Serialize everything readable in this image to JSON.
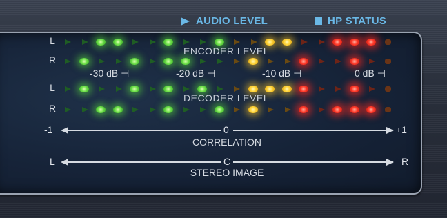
{
  "header": {
    "audio_level": "AUDIO LEVEL",
    "hp_status": "HP STATUS",
    "accent": "#6ab8e6"
  },
  "meters": {
    "encoder_label": "ENCODER LEVEL",
    "decoder_label": "DECODER LEVEL",
    "db_marks": [
      "-30 dB ⊣",
      "-20 dB ⊣",
      "-10 dB ⊣",
      "0 dB ⊣"
    ],
    "rows": [
      {
        "label": "L",
        "leds": [
          "og",
          "og",
          "g",
          "g",
          "og",
          "og",
          "g",
          "og",
          "og",
          "g",
          "oy",
          "oy",
          "y",
          "y",
          "or",
          "or",
          "r",
          "r",
          "r",
          "oo"
        ]
      },
      {
        "label": "R",
        "leds": [
          "og",
          "g",
          "og",
          "og",
          "g",
          "og",
          "g",
          "g",
          "og",
          "og",
          "oy",
          "y",
          "oy",
          "oy",
          "r",
          "or",
          "or",
          "r",
          "or",
          "oo"
        ]
      },
      {
        "label": "L",
        "leds": [
          "og",
          "g",
          "og",
          "og",
          "g",
          "og",
          "g",
          "og",
          "g",
          "og",
          "oy",
          "y",
          "y",
          "y",
          "r",
          "or",
          "or",
          "r",
          "or",
          "oo"
        ]
      },
      {
        "label": "R",
        "leds": [
          "og",
          "og",
          "g",
          "g",
          "og",
          "og",
          "g",
          "og",
          "og",
          "g",
          "oy",
          "y",
          "oy",
          "oy",
          "r",
          "or",
          "r",
          "r",
          "r",
          "oo"
        ]
      }
    ]
  },
  "correlation": {
    "left": "-1",
    "center": "0",
    "right": "+1",
    "caption": "CORRELATION"
  },
  "stereo_image": {
    "left": "L",
    "center": "C",
    "right": "R",
    "caption": "STEREO IMAGE"
  }
}
